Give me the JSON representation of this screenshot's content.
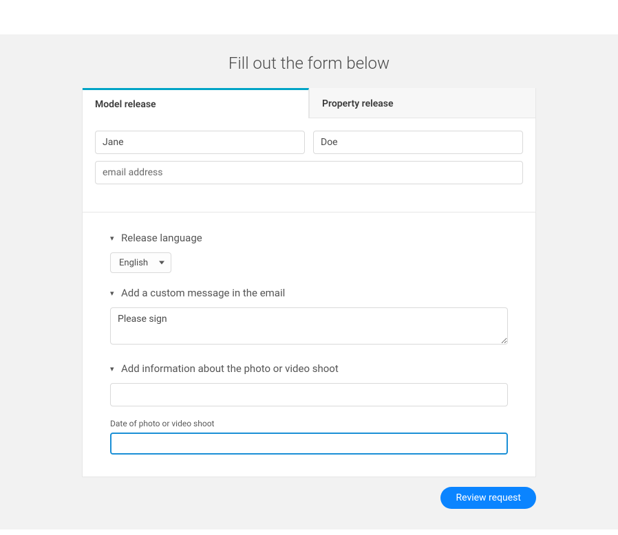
{
  "header": {
    "title": "Fill out the form below"
  },
  "tabs": {
    "model": "Model release",
    "property": "Property release"
  },
  "fields": {
    "first_name": "Jane",
    "last_name": "Doe",
    "email_placeholder": "email address",
    "email_value": ""
  },
  "sections": {
    "language": {
      "title": "Release language",
      "selected": "English"
    },
    "message": {
      "title": "Add a custom message in the email",
      "value": "Please sign"
    },
    "info": {
      "title": "Add information about the photo or video shoot",
      "value": "",
      "date_label": "Date of photo or video shoot",
      "date_value": ""
    }
  },
  "buttons": {
    "review": "Review request"
  }
}
